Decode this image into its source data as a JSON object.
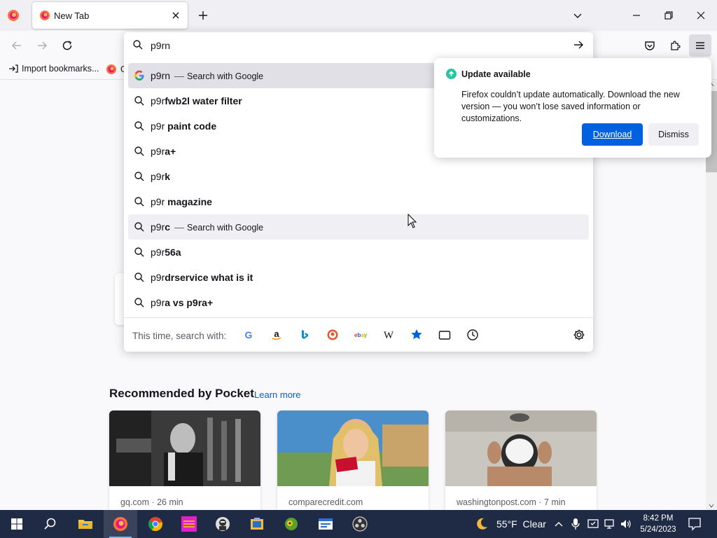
{
  "tab": {
    "title": "New Tab"
  },
  "bookmarks": {
    "import_label": "Import bookmarks...",
    "truncated_label": "G"
  },
  "urlbar": {
    "value": "p9rn",
    "results": [
      {
        "typed": "p9rn",
        "bold": "",
        "action": "Search with Google",
        "type": "engine"
      },
      {
        "typed": "p9r",
        "bold": "fwb2l water filter",
        "type": "suggestion"
      },
      {
        "typed": "p9r",
        "bold": " paint code",
        "type": "suggestion"
      },
      {
        "typed": "p9r",
        "bold": "a+",
        "type": "suggestion"
      },
      {
        "typed": "p9r",
        "bold": "k",
        "type": "suggestion"
      },
      {
        "typed": "p9r",
        "bold": " magazine",
        "type": "suggestion"
      },
      {
        "typed": "p9r",
        "bold": "c",
        "action": "Search with Google",
        "type": "suggestion-hover"
      },
      {
        "typed": "p9r",
        "bold": "56a",
        "type": "suggestion"
      },
      {
        "typed": "p9r",
        "bold": "drservice what is it",
        "type": "suggestion"
      },
      {
        "typed": "p9r",
        "bold": "a vs p9ra+",
        "type": "suggestion"
      }
    ],
    "oneoff_label": "This time, search with:",
    "engines": [
      "google-icon",
      "amazon-icon",
      "bing-icon",
      "duckduckgo-icon",
      "ebay-icon",
      "wikipedia-icon",
      "bookmarks-icon",
      "tabs-icon",
      "history-icon"
    ]
  },
  "update": {
    "title": "Update available",
    "body": "Firefox couldn’t update automatically. Download the new version — you won’t lose saved information or customizations.",
    "download_label": "Download",
    "dismiss_label": "Dismiss"
  },
  "pocket": {
    "heading": "Recommended by Pocket",
    "learn_more": "Learn more",
    "cards": [
      {
        "source": "gq.com · 26 min"
      },
      {
        "source": "comparecredit.com"
      },
      {
        "source": "washingtonpost.com · 7 min"
      }
    ]
  },
  "taskbar": {
    "weather": "55°F  Clear",
    "time": "8:42 PM",
    "date": "5/24/2023"
  },
  "colors": {
    "accent": "#0061e0",
    "taskbar": "#1f2a44",
    "update_green": "#2ac3a2"
  }
}
